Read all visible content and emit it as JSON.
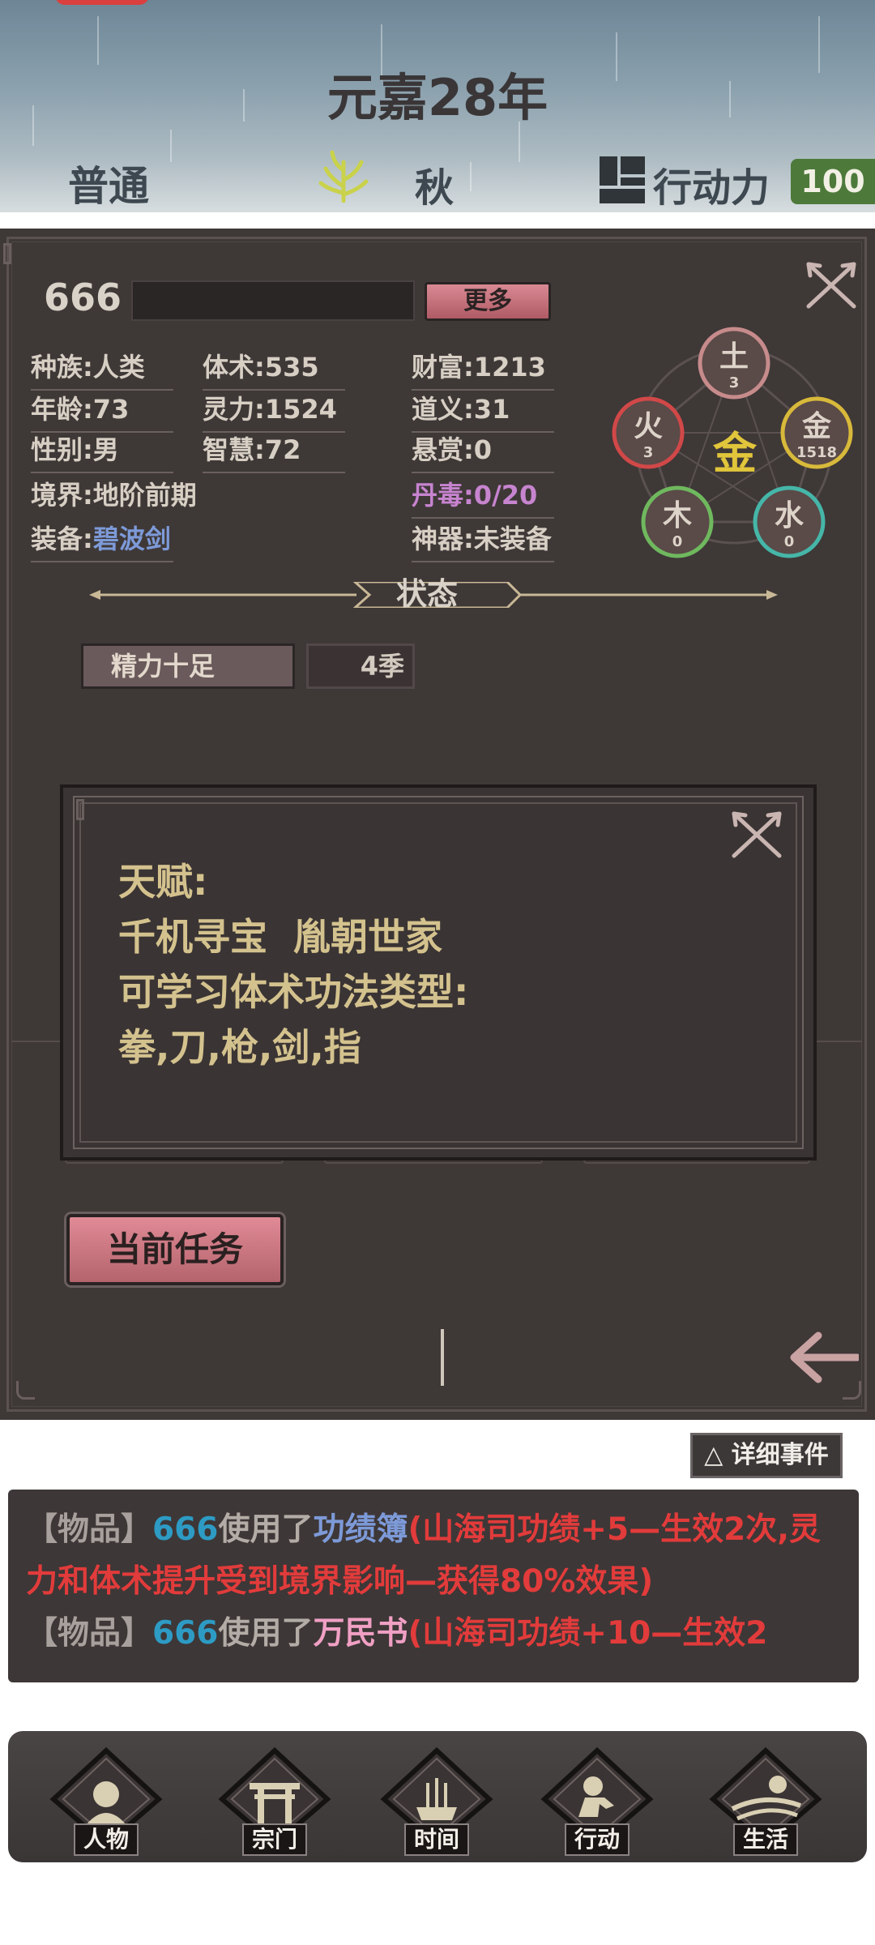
{
  "header": {
    "year": "元嘉28年",
    "mode": "普通",
    "season": "秋",
    "action_label": "行动力",
    "action_value": "100"
  },
  "character": {
    "name": "666",
    "more_button": "更多",
    "stats": {
      "race": "种族:人类",
      "age": "年龄:73",
      "gender": "性别:男",
      "realm": "境界:地阶前期",
      "equipment_label": "装备:",
      "equipment_value": "碧波剑",
      "body": "体术:535",
      "spirit": "灵力:1524",
      "wisdom": "智慧:72",
      "wealth": "财富:1213",
      "righteousness": "道义:31",
      "bounty": "悬赏:0",
      "pill_poison": "丹毒:0/20",
      "artifact": "神器:未装备"
    }
  },
  "elements": {
    "center": "金",
    "nodes": [
      {
        "name": "土",
        "value": "3",
        "color": "#c78b8b"
      },
      {
        "name": "金",
        "value": "1518",
        "color": "#d8b93a"
      },
      {
        "name": "水",
        "value": "0",
        "color": "#45b6a8"
      },
      {
        "name": "木",
        "value": "0",
        "color": "#6fb85e"
      },
      {
        "name": "火",
        "value": "3",
        "color": "#d14848"
      }
    ]
  },
  "status": {
    "title": "状态",
    "buff_name": "精力十足",
    "buff_duration": "4季"
  },
  "talent_popup": {
    "line1": "天赋:",
    "line2": "千机寻宝  胤朝世家",
    "line3": "可学习体术功法类型:",
    "line4": "拳,刀,枪,剑,指"
  },
  "task_button": "当前任务",
  "detail_button": "△ 详细事件",
  "log": [
    {
      "tag": "【物品】",
      "name": "666",
      "verb": "使用了",
      "item": "功绩簿",
      "effect": "(山海司功绩+5—生效2次,灵力和体术提升受到境界影响—获得80%效果)"
    },
    {
      "tag": "【物品】",
      "name": "666",
      "verb": "使用了",
      "item": "万民书",
      "effect": "(山海司功绩+10—生效2"
    }
  ],
  "nav": [
    "人物",
    "宗门",
    "时间",
    "行动",
    "生活"
  ]
}
